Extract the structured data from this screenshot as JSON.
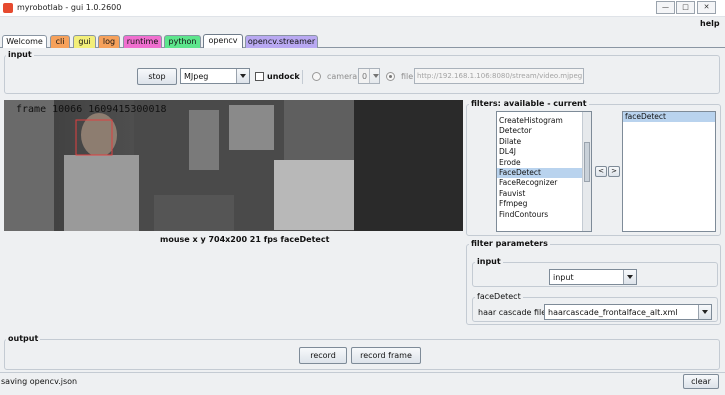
{
  "window": {
    "title": "myrobotlab - gui 1.0.2600",
    "help_label": "help"
  },
  "tabs": [
    {
      "label": "Welcome",
      "color": "#ffffff"
    },
    {
      "label": "cli",
      "color": "#f6a15b"
    },
    {
      "label": "gui",
      "color": "#f3ef7a"
    },
    {
      "label": "log",
      "color": "#f6a15b"
    },
    {
      "label": "runtime",
      "color": "#f06fcf"
    },
    {
      "label": "python",
      "color": "#5de58c"
    },
    {
      "label": "opencv",
      "color": "#ffffff"
    },
    {
      "label": "opencv.streamer",
      "color": "#b9a9f2"
    }
  ],
  "input": {
    "label": "input",
    "stop_label": "stop",
    "grabber_value": "MJpeg",
    "undock_label": "undock",
    "camera_label": "camera",
    "camera_index": "0",
    "file_label": "file",
    "file_path": "http://192.168.1.106:8080/stream/video.mjpeg"
  },
  "video": {
    "overlay_text": "frame 10066 1609415300018",
    "status": "mouse x y 704x200  21 fps  faceDetect"
  },
  "filters": {
    "label": "filters: available - current",
    "available": [
      "CreateHistogram",
      "Detector",
      "Dilate",
      "DL4J",
      "Erode",
      "FaceDetect",
      "FaceRecognizer",
      "Fauvist",
      "Ffmpeg",
      "FindContours"
    ],
    "selected_available": "FaceDetect",
    "current": [
      "faceDetect"
    ],
    "remove_label": "<",
    "add_label": ">"
  },
  "filter_parameters": {
    "label": "filter parameters",
    "input_group_label": "input",
    "input_value": "input",
    "facedetect_group_label": "faceDetect",
    "cascade_label": "haar cascade file",
    "cascade_value": "haarcascade_frontalface_alt.xml"
  },
  "output": {
    "label": "output",
    "record_label": "record",
    "record_frame_label": "record frame"
  },
  "status_bar": {
    "message": "saving opencv.json",
    "clear_label": "clear"
  }
}
